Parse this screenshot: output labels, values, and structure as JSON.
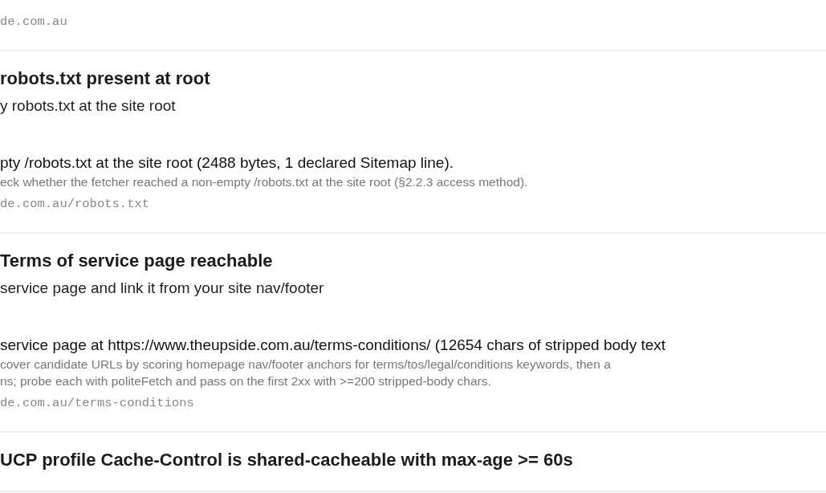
{
  "checks": [
    {
      "url": "de.com.au"
    },
    {
      "title": "robots.txt present at root",
      "fix": "y robots.txt at the site root",
      "detail": "pty /robots.txt at the site root (2488 bytes, 1 declared Sitemap line).",
      "method": [
        "eck whether the fetcher reached a non-empty /robots.txt at the site root (§2.2.3 access method)."
      ],
      "url": "de.com.au/robots.txt"
    },
    {
      "title": "Terms of service page reachable",
      "fix": "service page and link it from your site nav/footer",
      "detail": "service page at https://www.theupside.com.au/terms-conditions/ (12654 chars of stripped body text",
      "method": [
        "cover candidate URLs by scoring homepage nav/footer anchors for terms/tos/legal/conditions keywords, then a",
        "ns; probe each with politeFetch and pass on the first 2xx with >=200 stripped-body chars."
      ],
      "url": "de.com.au/terms-conditions"
    },
    {
      "title": "UCP profile Cache-Control is shared-cacheable with max-age >= 60s"
    }
  ]
}
